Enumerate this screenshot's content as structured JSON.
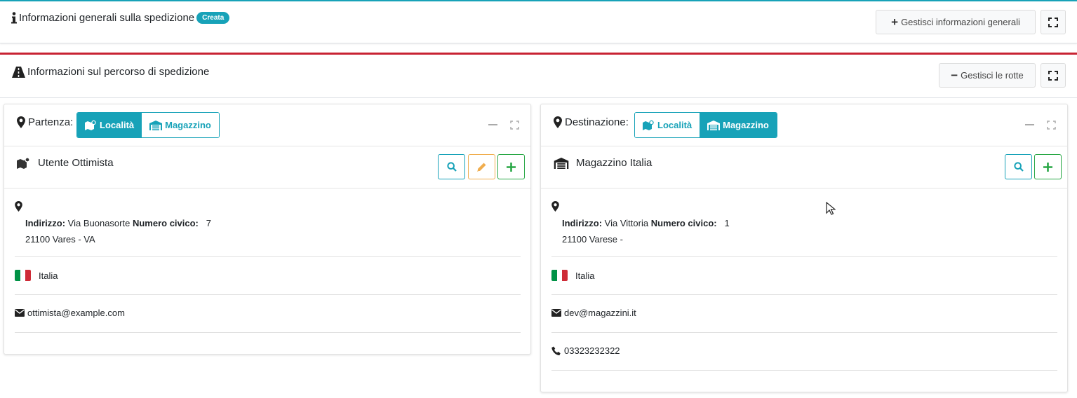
{
  "general": {
    "title": "Informazioni generali sulla spedizione",
    "badge": "Creata",
    "manage_label": "Gestisci informazioni generali",
    "border_color": "#17a2b8"
  },
  "route": {
    "title": "Informazioni sul percorso di spedizione",
    "manage_label": "Gestisci le rotte",
    "border_color": "#c82333"
  },
  "departure": {
    "label": "Partenza:",
    "toggle": {
      "option1": "Località",
      "option2": "Magazzino",
      "active": "Località"
    },
    "name": "Utente Ottimista",
    "address_label": "Indirizzo:",
    "address": "Via Buonasorte",
    "number_label": "Numero civico:",
    "number": "7",
    "city_line": "21100 Vares - VA",
    "country": "Italia",
    "email": "ottimista@example.com",
    "actions": [
      "search-icon",
      "pencil-icon",
      "plus-icon"
    ]
  },
  "destination": {
    "label": "Destinazione:",
    "toggle": {
      "option1": "Località",
      "option2": "Magazzino",
      "active": "Magazzino"
    },
    "name": "Magazzino Italia",
    "address_label": "Indirizzo:",
    "address": "Via Vittoria",
    "number_label": "Numero civico:",
    "number": "1",
    "city_line": "21100 Varese -",
    "country": "Italia",
    "email": "dev@magazzini.it",
    "phone": "03323232322",
    "actions": [
      "search-icon",
      "plus-icon"
    ]
  },
  "colors": {
    "info": "#17a2b8",
    "warning": "#f0ad4e",
    "success": "#28a745"
  }
}
